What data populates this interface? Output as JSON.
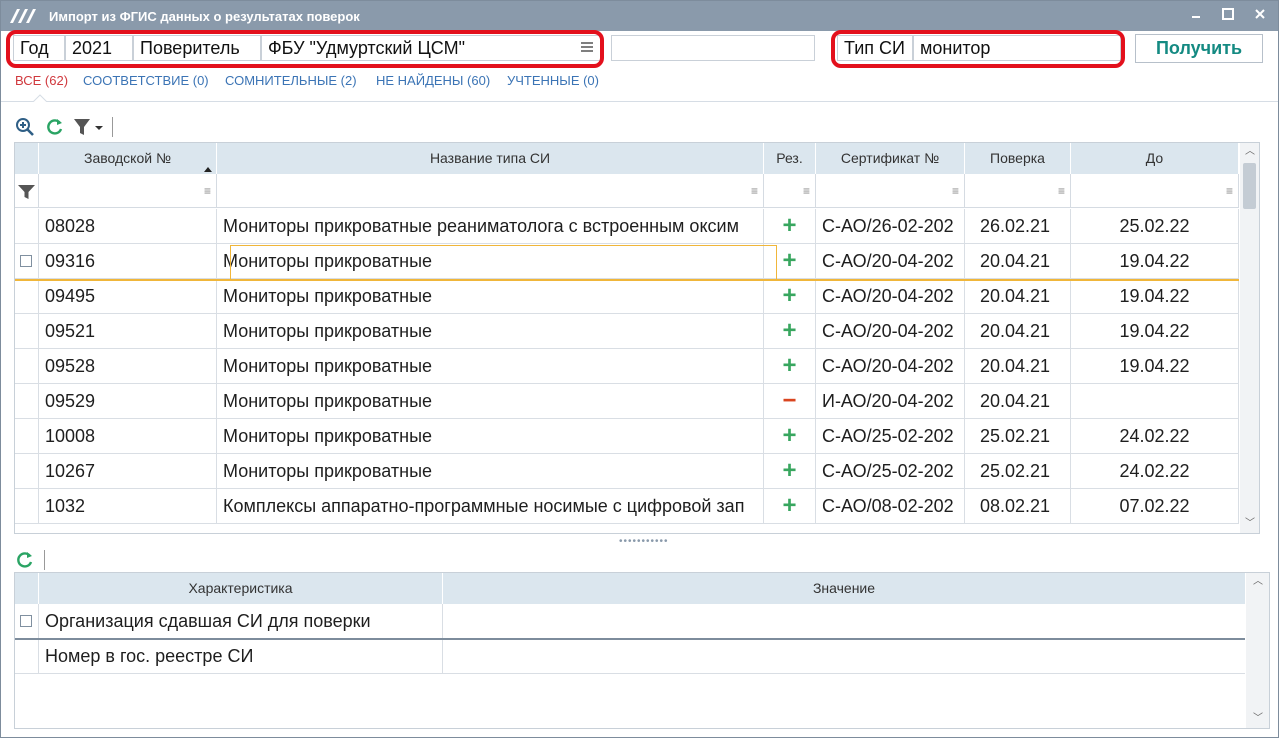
{
  "window": {
    "title": "Импорт из ФГИС данных о результатах поверок"
  },
  "filters": {
    "year_label": "Год",
    "year_value": "2021",
    "verifier_label": "Поверитель",
    "verifier_value": "ФБУ \"Удмуртский ЦСМ\"",
    "extra_value": "",
    "type_label": "Тип СИ",
    "type_value": "монитор",
    "get_button": "Получить"
  },
  "tabs": [
    {
      "label": "ВСЕ (62)",
      "active": true
    },
    {
      "label": "СООТВЕТСТВИЕ (0)",
      "active": false
    },
    {
      "label": "СОМНИТЕЛЬНЫЕ (2)",
      "active": false
    },
    {
      "label": "НЕ НАЙДЕНЫ (60)",
      "active": false
    },
    {
      "label": "УЧТЕННЫЕ (0)",
      "active": false
    }
  ],
  "grid": {
    "columns": [
      "Заводской №",
      "Название типа СИ",
      "Рез.",
      "Сертификат №",
      "Поверка",
      "До"
    ],
    "rows": [
      {
        "serial": "08028",
        "name": "Мониторы прикроватные реаниматолога с встроенным оксим",
        "result": "+",
        "cert": "С-АО/26-02-202",
        "verified": "26.02.21",
        "until": "25.02.22"
      },
      {
        "serial": "09316",
        "name": "Мониторы прикроватные",
        "result": "+",
        "cert": "С-АО/20-04-202",
        "verified": "20.04.21",
        "until": "19.04.22"
      },
      {
        "serial": "09495",
        "name": "Мониторы прикроватные",
        "result": "+",
        "cert": "С-АО/20-04-202",
        "verified": "20.04.21",
        "until": "19.04.22"
      },
      {
        "serial": "09521",
        "name": "Мониторы прикроватные",
        "result": "+",
        "cert": "С-АО/20-04-202",
        "verified": "20.04.21",
        "until": "19.04.22"
      },
      {
        "serial": "09528",
        "name": "Мониторы прикроватные",
        "result": "+",
        "cert": "С-АО/20-04-202",
        "verified": "20.04.21",
        "until": "19.04.22"
      },
      {
        "serial": "09529",
        "name": "Мониторы прикроватные",
        "result": "−",
        "cert": "И-АО/20-04-202",
        "verified": "20.04.21",
        "until": ""
      },
      {
        "serial": "10008",
        "name": "Мониторы прикроватные",
        "result": "+",
        "cert": "С-АО/25-02-202",
        "verified": "25.02.21",
        "until": "24.02.22"
      },
      {
        "serial": "10267",
        "name": "Мониторы прикроватные",
        "result": "+",
        "cert": "С-АО/25-02-202",
        "verified": "25.02.21",
        "until": "24.02.22"
      },
      {
        "serial": "1032",
        "name": "Комплексы аппаратно-программные носимые с цифровой зап",
        "result": "+",
        "cert": "С-АО/08-02-202",
        "verified": "08.02.21",
        "until": "07.02.22"
      }
    ]
  },
  "details": {
    "columns": [
      "Характеристика",
      "Значение"
    ],
    "rows": [
      {
        "name": "Организация сдавшая СИ для поверки",
        "value": ""
      },
      {
        "name": "Номер в гос. реестре СИ",
        "value": ""
      }
    ]
  },
  "colors": {
    "titlebar": "#8a9aab",
    "header": "#dbe6ee",
    "accent_red": "#e3101c",
    "selection": "#f0b63a",
    "plus": "#38a65f",
    "minus": "#d9451f",
    "button_text": "#148a82"
  },
  "icons": [
    "app-logo-icon",
    "minimize-icon",
    "maximize-icon",
    "close-icon",
    "list-menu-icon",
    "zoom-in-icon",
    "refresh-icon",
    "filter-icon",
    "funnel-icon"
  ]
}
